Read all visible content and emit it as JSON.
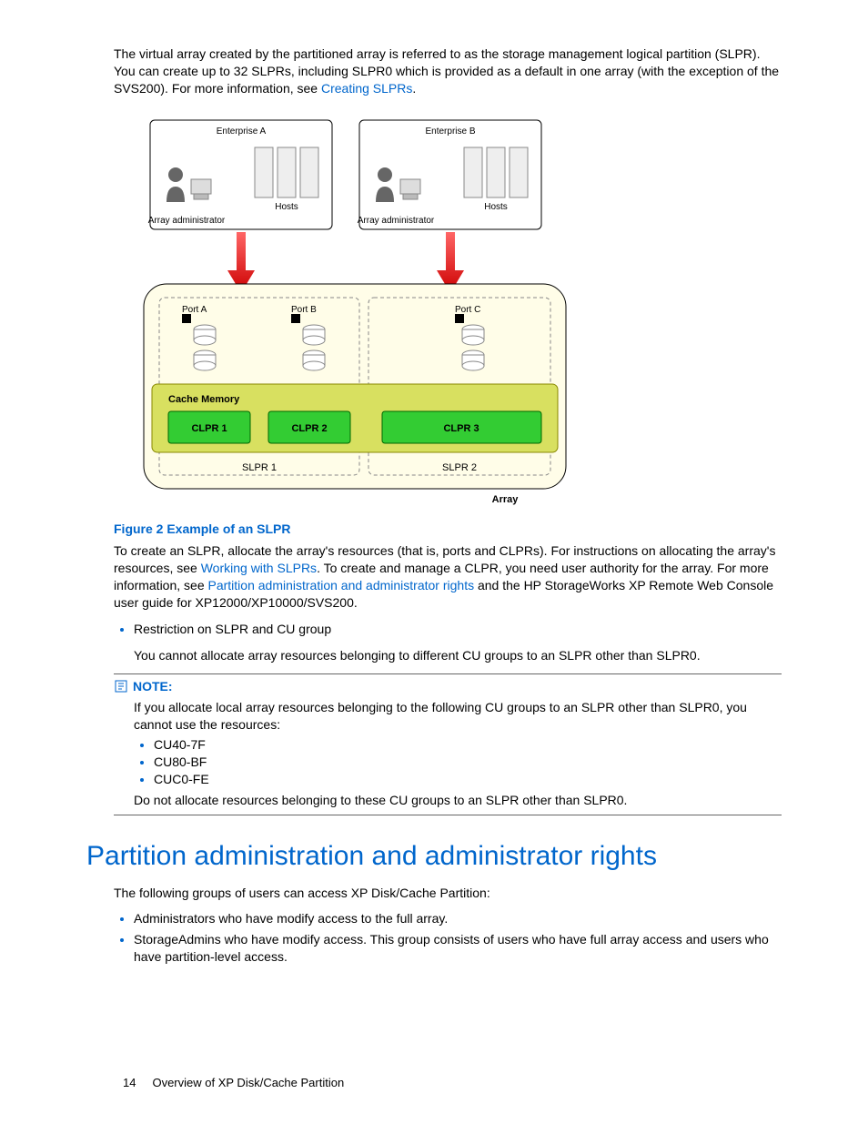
{
  "intro": {
    "p1_a": "The virtual array created by the partitioned array is referred to as the storage management logical partition (SLPR). You can create up to 32 SLPRs, including SLPR0 which is provided as a default in one array (with the exception of the SVS200). For more information, see ",
    "p1_link": "Creating SLPRs",
    "p1_b": "."
  },
  "diagram": {
    "entA": "Enterprise A",
    "entB": "Enterprise B",
    "hosts": "Hosts",
    "admin": "Array administrator",
    "portA": "Port A",
    "portB": "Port B",
    "portC": "Port C",
    "cache": "Cache Memory",
    "clpr1": "CLPR 1",
    "clpr2": "CLPR 2",
    "clpr3": "CLPR 3",
    "slpr1": "SLPR 1",
    "slpr2": "SLPR 2",
    "array": "Array"
  },
  "figure_caption": "Figure 2 Example of an SLPR",
  "para2": {
    "a": "To create an SLPR, allocate the array's resources (that is, ports and CLPRs). For instructions on allocating the array's resources, see ",
    "link1": "Working with SLPRs",
    "b": ". To create and manage a CLPR, you need user authority for the array. For more information, see ",
    "link2": "Partition administration and administrator rights",
    "c": " and the HP StorageWorks XP Remote Web Console user guide for XP12000/XP10000/SVS200."
  },
  "bullet1": "Restriction on SLPR and CU group",
  "bullet1_sub": "You cannot allocate array resources belonging to different CU groups to an SLPR other than SLPR0.",
  "note": {
    "label": "NOTE:",
    "intro": "If you allocate local array resources belonging to the following CU groups to an SLPR other than SLPR0, you cannot use the resources:",
    "items": [
      "CU40-7F",
      "CU80-BF",
      "CUC0-FE"
    ],
    "outro": "Do not allocate resources belonging to these CU groups to an SLPR other than SLPR0."
  },
  "section_title": "Partition administration and administrator rights",
  "section_intro": "The following groups of users can access XP Disk/Cache Partition:",
  "section_bullets": [
    "Administrators who have modify access to the full array.",
    "StorageAdmins who have modify access. This group consists of users who have full array access and users who have partition-level access."
  ],
  "footer": {
    "page": "14",
    "title": "Overview of XP Disk/Cache Partition"
  }
}
